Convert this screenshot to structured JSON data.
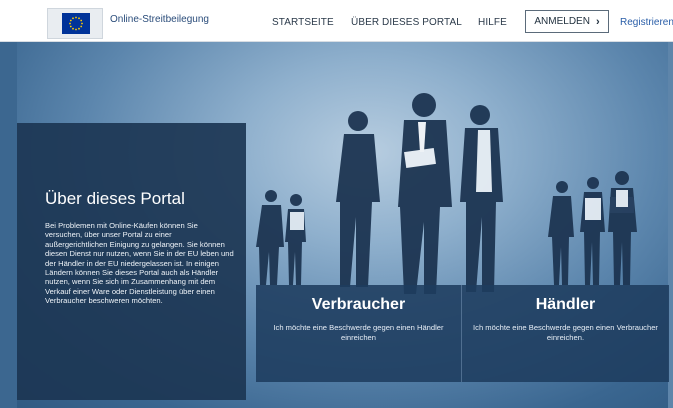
{
  "header": {
    "site_name": "Online-Streitbeilegung",
    "nav": {
      "start": "STARTSEITE",
      "about": "ÜBER DIESES PORTAL",
      "help": "HILFE"
    },
    "login": "ANMELDEN",
    "register": "Registrieren"
  },
  "info": {
    "title": "Über dieses Portal",
    "text": "Bei Problemen mit Online-Käufen können Sie versuchen, über unser Portal zu einer außergerichtlichen Einigung zu gelangen. Sie können diesen Dienst nur nutzen, wenn Sie in der EU leben und der Händler in der EU niedergelassen ist. In einigen Ländern können Sie dieses Portal auch als Händler nutzen, wenn Sie sich im Zusammenhang mit dem Verkauf einer Ware oder Dienstleistung über einen Verbraucher beschweren möchten."
  },
  "choices": {
    "consumer": {
      "title": "Verbraucher",
      "text": "Ich möchte eine Beschwerde gegen einen Händler einreichen"
    },
    "trader": {
      "title": "Händler",
      "text": "Ich möchte eine Beschwerde gegen einen Verbraucher einreichen."
    }
  },
  "colors": {
    "eu_blue": "#003399",
    "eu_star": "#FFCC00",
    "panel": "#1c3654"
  }
}
